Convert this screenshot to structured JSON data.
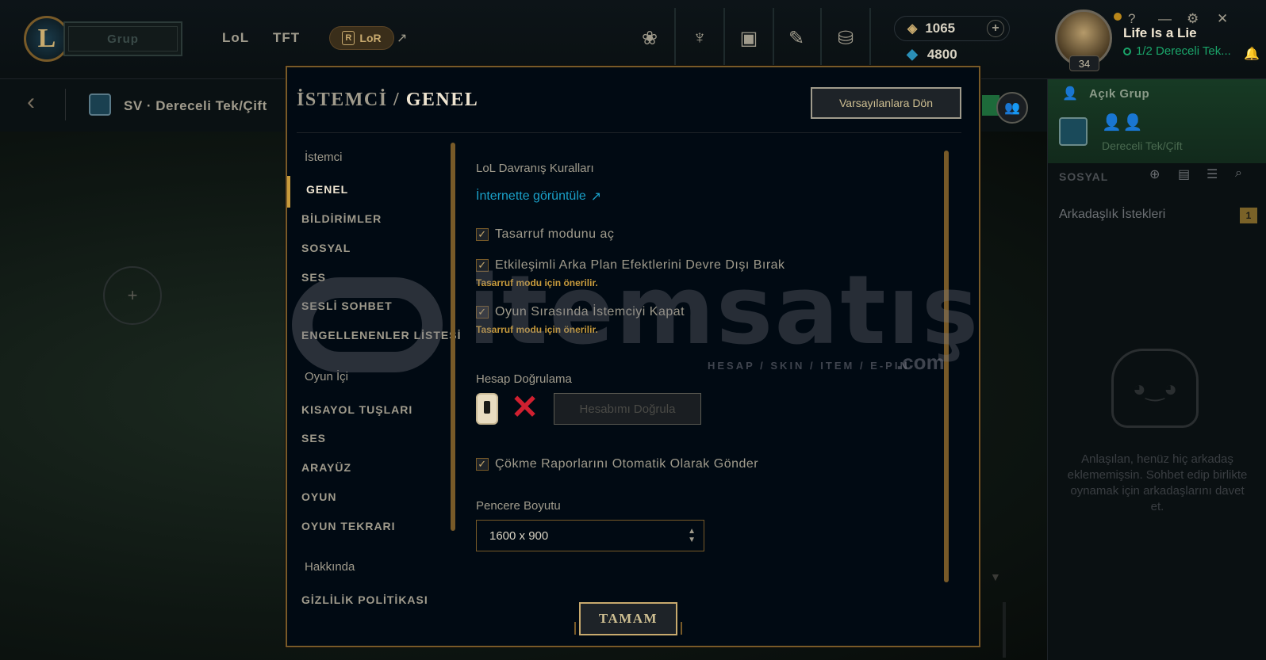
{
  "topbar": {
    "play_label": "Grup",
    "nav": [
      "LoL",
      "TFT"
    ],
    "lor_label": "LoR",
    "lor_badge": "R",
    "ext_arrow": "↗",
    "nav_icons": [
      "home-icon",
      "tft-icon",
      "collection-icon",
      "loot-icon",
      "store-icon"
    ],
    "rp": "1065",
    "be": "4800",
    "currency_add": "+"
  },
  "profile": {
    "name": "Life Is a Lie",
    "status": "1/2 Dereceli Tek...",
    "level": "34",
    "window_controls": [
      "?",
      "—",
      "⚙",
      "✕"
    ]
  },
  "lobby": {
    "queue_title": "SV · Dereceli Tek/Çift",
    "empty_slot": "+"
  },
  "social": {
    "open_party": "Açık Grup",
    "party_queue": "Dereceli Tek/Çift",
    "header": "SOSYAL",
    "friend_requests": "Arkadaşlık İstekleri",
    "request_count": "1",
    "no_friends": "Anlaşılan, henüz hiç arkadaş eklememişsin. Sohbet edip birlikte oynamak için arkadaşlarını davet et."
  },
  "modal": {
    "title_parent": "İSTEMCİ",
    "title_sep": "/",
    "title_current": "GENEL",
    "reset_button": "Varsayılanlara Dön",
    "ok_button": "TAMAM",
    "sidebar": {
      "section_client": "İstemci",
      "client_items": [
        "GENEL",
        "BİLDİRİMLER",
        "SOSYAL",
        "SES",
        "SESLİ SOHBET",
        "ENGELLENENLER LİSTESİ"
      ],
      "section_ingame": "Oyun İçi",
      "ingame_items": [
        "KISAYOL TUŞLARI",
        "SES",
        "ARAYÜZ",
        "OYUN",
        "OYUN TEKRARI"
      ],
      "section_about": "Hakkında",
      "about_items": [
        "GİZLİLİK POLİTİKASI"
      ]
    },
    "content": {
      "conduct_label": "LoL Davranış Kuralları",
      "conduct_link": "İnternette görüntüle",
      "low_spec": "Tasarruf modunu aç",
      "disable_bg": "Etkileşimli Arka Plan Efektlerini Devre Dışı Bırak",
      "hint1": "Tasarruf modu için önerilir.",
      "close_client": "Oyun Sırasında İstemciyi Kapat",
      "hint2": "Tasarruf modu için önerilir.",
      "verify_label": "Hesap Doğrulama",
      "verify_button": "Hesabımı Doğrula",
      "crash_reports": "Çökme Raporlarını Otomatik Olarak Gönder",
      "window_size_label": "Pencere Boyutu",
      "window_size_value": "1600 x 900",
      "checked": [
        true,
        true,
        true,
        true
      ]
    }
  },
  "watermark": {
    "text": "itemsatış",
    "sub": "HESAP / SKIN / ITEM / E-PIN",
    "tld": ".com"
  }
}
